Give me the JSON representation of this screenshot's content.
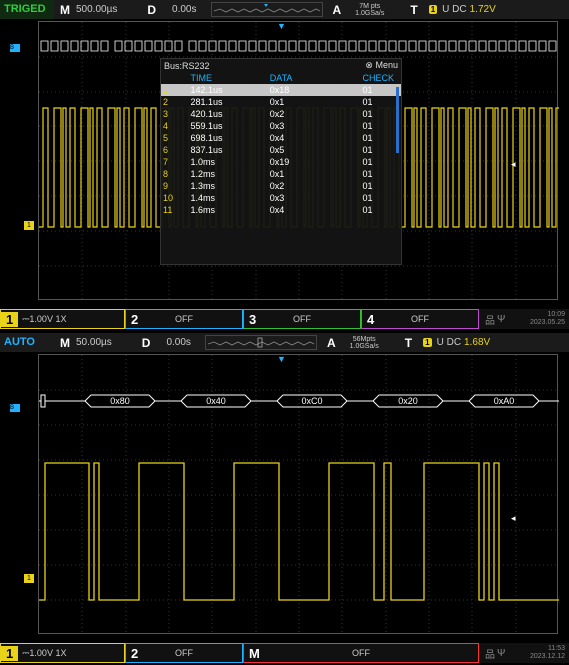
{
  "colors": {
    "ch1": "#e8d21a",
    "ch2": "#1fb3ff",
    "ch3": "#31c131",
    "ch4": "#c14cd3",
    "trig_green": "#2ecc40",
    "auto_blue": "#1fb3ff",
    "math_red": "#ff3333"
  },
  "top": {
    "status": "TRIGED",
    "timebase_label": "M",
    "timebase": "500.00µs",
    "delay_label": "D",
    "delay": "0.00s",
    "acq_label": "A",
    "mem_pts": "7M pts",
    "sample_rate": "1.0GSa/s",
    "trig_label": "T",
    "trig_src": "1",
    "trig_type": "U DC",
    "trig_level": "1.72V",
    "decode": {
      "bus": "Bus:RS232",
      "menu": "Menu",
      "columns": [
        "TIME",
        "DATA",
        "CHECK"
      ],
      "rows": [
        {
          "idx": "1",
          "time": "142.1us",
          "data": "0x18",
          "check": "01"
        },
        {
          "idx": "2",
          "time": "281.1us",
          "data": "0x1",
          "check": "01"
        },
        {
          "idx": "3",
          "time": "420.1us",
          "data": "0x2",
          "check": "01"
        },
        {
          "idx": "4",
          "time": "559.1us",
          "data": "0x3",
          "check": "01"
        },
        {
          "idx": "5",
          "time": "698.1us",
          "data": "0x4",
          "check": "01"
        },
        {
          "idx": "6",
          "time": "837.1us",
          "data": "0x5",
          "check": "01"
        },
        {
          "idx": "7",
          "time": "1.0ms",
          "data": "0x19",
          "check": "01"
        },
        {
          "idx": "8",
          "time": "1.2ms",
          "data": "0x1",
          "check": "01"
        },
        {
          "idx": "9",
          "time": "1.3ms",
          "data": "0x2",
          "check": "01"
        },
        {
          "idx": "10",
          "time": "1.4ms",
          "data": "0x3",
          "check": "01"
        },
        {
          "idx": "11",
          "time": "1.6ms",
          "data": "0x4",
          "check": "01"
        }
      ]
    },
    "bottom": {
      "ch1_num": "1",
      "ch1_setting": "1.00V 1X",
      "ch2_num": "2",
      "ch2_state": "OFF",
      "ch3_num": "3",
      "ch3_state": "OFF",
      "ch4_num": "4",
      "ch4_state": "OFF",
      "time": "10:09",
      "date": "2023.05.25"
    }
  },
  "bottom_panel": {
    "status": "AUTO",
    "timebase_label": "M",
    "timebase": "50.00µs",
    "delay_label": "D",
    "delay": "0.00s",
    "acq_label": "A",
    "mem_pts": "56Mpts",
    "sample_rate": "1.0GSa/s",
    "trig_label": "T",
    "trig_src": "1",
    "trig_type": "U DC",
    "trig_level": "1.68V",
    "bus_values": [
      "0x80",
      "0x40",
      "0xC0",
      "0x20",
      "0xA0"
    ],
    "bottom": {
      "ch1_num": "1",
      "ch1_setting": "1.00V 1X",
      "ch2_num": "2",
      "ch2_state": "OFF",
      "math_label": "M",
      "math_state": "OFF",
      "time": "11:53",
      "date": "2023.12.12"
    }
  },
  "icons": {
    "menu_close": "circle-x-icon",
    "usb": "usb-icon",
    "network": "network-icon"
  }
}
